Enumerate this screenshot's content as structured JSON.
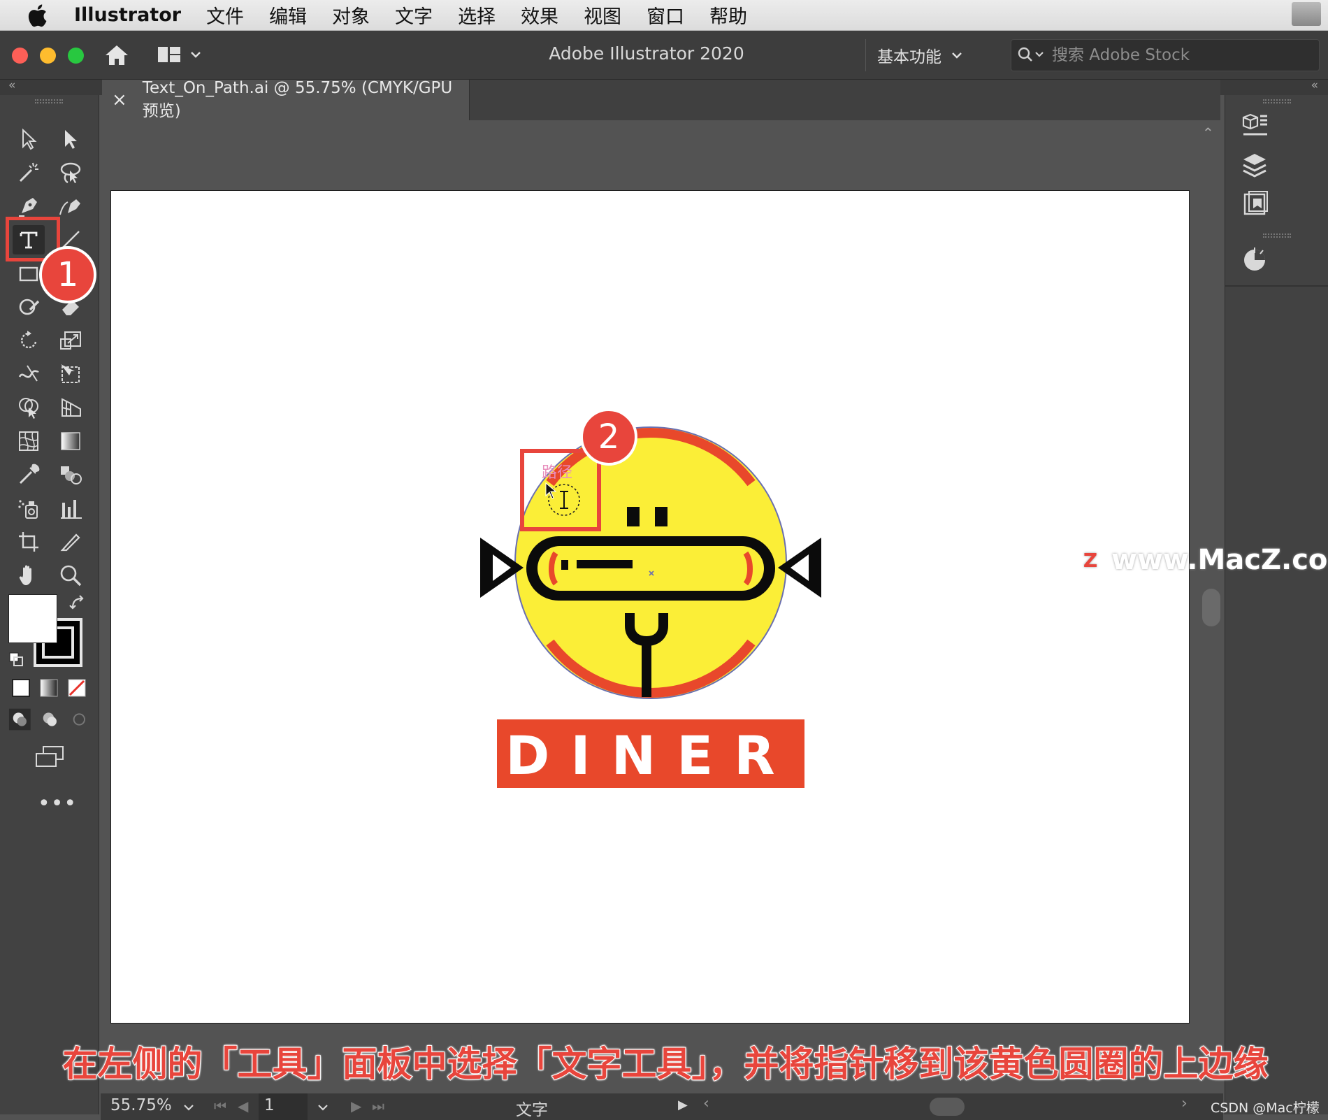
{
  "menubar": {
    "app_name": "Illustrator",
    "items": [
      "文件",
      "编辑",
      "对象",
      "文字",
      "选择",
      "效果",
      "视图",
      "窗口",
      "帮助"
    ]
  },
  "titlebar": {
    "title": "Adobe Illustrator 2020",
    "workspace": "基本功能",
    "search_placeholder": "搜索 Adobe Stock"
  },
  "document_tab": {
    "title": "Text_On_Path.ai @ 55.75% (CMYK/GPU 预览)",
    "close": "×"
  },
  "collapse": {
    "left": "«",
    "right": "«"
  },
  "artwork": {
    "banner_text": "DINER",
    "cursor_hint": "路径",
    "colors": {
      "yellow": "#fbee37",
      "red": "#e8482b",
      "black": "#0b0b0b",
      "outline": "#6a6fb0"
    }
  },
  "statusbar": {
    "zoom": "55.75%",
    "page": "1",
    "tool_name": "文字"
  },
  "annotations": {
    "badge_1": "1",
    "badge_2": "2",
    "caption": "在左侧的「工具」面板中选择「文字工具」，并将指针移到该黄色圆圈的上边缘",
    "watermark": "www.MacZ.com",
    "watermark_logo": "Z",
    "csdn": "CSDN @Mac柠檬"
  },
  "icons": [
    "apple-icon",
    "home-icon",
    "arrange-documents-icon",
    "search-icon",
    "selection-tool-icon",
    "direct-selection-tool-icon",
    "magic-wand-icon",
    "lasso-icon",
    "pen-tool-icon",
    "curvature-tool-icon",
    "type-tool-icon",
    "line-segment-icon",
    "shaper-icon",
    "eraser-icon",
    "rotate-icon",
    "scale-icon",
    "warp-icon",
    "free-transform-icon",
    "shape-builder-icon",
    "perspective-grid-icon",
    "mesh-icon",
    "gradient-icon",
    "eyedropper-icon",
    "blend-icon",
    "symbol-sprayer-icon",
    "column-graph-icon",
    "artboard-tool-icon",
    "slice-icon",
    "hand-icon",
    "zoom-icon",
    "properties-panel-icon",
    "layers-panel-icon",
    "libraries-panel-icon",
    "color-themes-icon"
  ]
}
